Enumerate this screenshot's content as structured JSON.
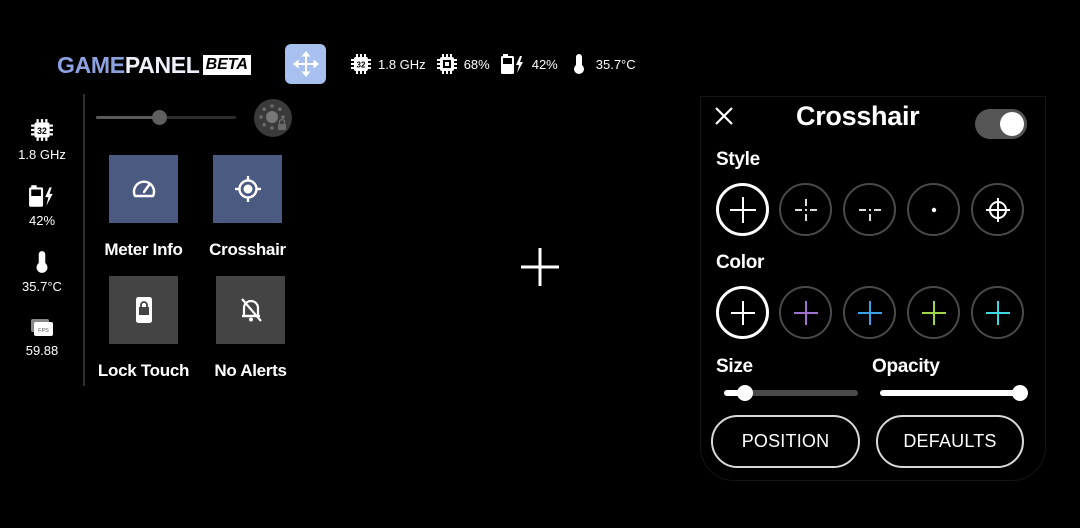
{
  "header": {
    "brand_part1": "GAME",
    "brand_part2": "PANEL",
    "brand_badge": "BETA",
    "move_button_icon": "move-arrows-icon",
    "stats": [
      {
        "icon": "cpu-32-icon",
        "value": "1.8 GHz"
      },
      {
        "icon": "cpu-chip-icon",
        "value": "68%"
      },
      {
        "icon": "battery-charging-icon",
        "value": "42%"
      },
      {
        "icon": "thermometer-icon",
        "value": "35.7°C"
      }
    ]
  },
  "sidebar": {
    "stats": [
      {
        "icon": "cpu-32-icon",
        "value": "1.8 GHz"
      },
      {
        "icon": "battery-charging-icon",
        "value": "42%"
      },
      {
        "icon": "thermometer-icon",
        "value": "35.7°C"
      },
      {
        "icon": "fps-icon",
        "value": "59.88",
        "icon_text": "FPS"
      }
    ]
  },
  "brightness": {
    "level": 0.45,
    "auto_icon": "auto-brightness-lock-icon"
  },
  "tiles": [
    {
      "label": "Meter Info",
      "icon": "speedometer-icon",
      "active": true
    },
    {
      "label": "Crosshair",
      "icon": "crosshair-target-icon",
      "active": true
    },
    {
      "label": "Lock Touch",
      "icon": "phone-lock-icon",
      "active": false
    },
    {
      "label": "No Alerts",
      "icon": "bell-off-icon",
      "active": false
    }
  ],
  "crosshair_panel": {
    "title": "Crosshair",
    "enabled": true,
    "style_label": "Style",
    "styles": [
      {
        "name": "plus",
        "selected": true
      },
      {
        "name": "dashed-plus",
        "selected": false
      },
      {
        "name": "dashed-t",
        "selected": false
      },
      {
        "name": "dot",
        "selected": false
      },
      {
        "name": "scope",
        "selected": false
      }
    ],
    "color_label": "Color",
    "colors": [
      {
        "hex": "#ffffff",
        "selected": true
      },
      {
        "hex": "#a070d0",
        "selected": false
      },
      {
        "hex": "#3aa0e8",
        "selected": false
      },
      {
        "hex": "#9ed84a",
        "selected": false
      },
      {
        "hex": "#40d8e0",
        "selected": false
      }
    ],
    "size_label": "Size",
    "size_value": 0.16,
    "opacity_label": "Opacity",
    "opacity_value": 1.0,
    "position_button": "POSITION",
    "defaults_button": "DEFAULTS"
  }
}
